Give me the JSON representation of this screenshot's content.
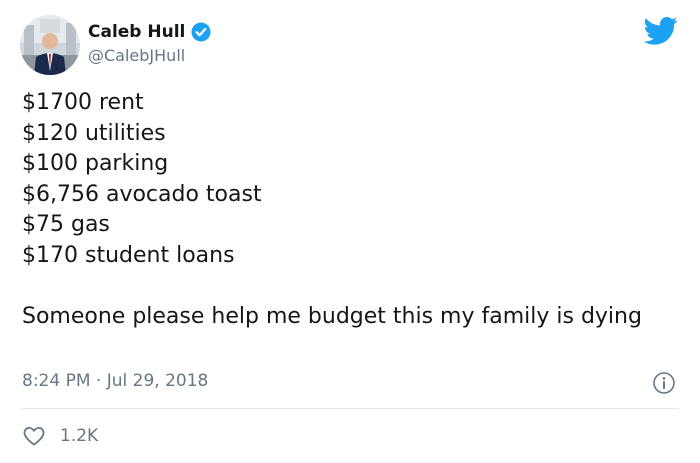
{
  "author": {
    "display_name": "Caleb Hull",
    "handle": "@CalebJHull",
    "verified": true
  },
  "tweet": {
    "lines": [
      "$1700 rent",
      "$120 utilities",
      "$100 parking",
      "$6,756 avocado toast",
      "$75 gas",
      "$170 student loans"
    ],
    "closing": "Someone please help me budget this my family is dying",
    "timestamp": "8:24 PM · Jul 29, 2018"
  },
  "engagement": {
    "likes": "1.2K"
  },
  "icons": {
    "brand": "twitter-bird-icon",
    "verified": "verified-badge-icon",
    "info": "info-icon",
    "like": "heart-icon"
  },
  "colors": {
    "brand_blue": "#1da1f2",
    "text_primary": "#14171a",
    "text_secondary": "#657786",
    "divider": "#e1e8ed"
  }
}
